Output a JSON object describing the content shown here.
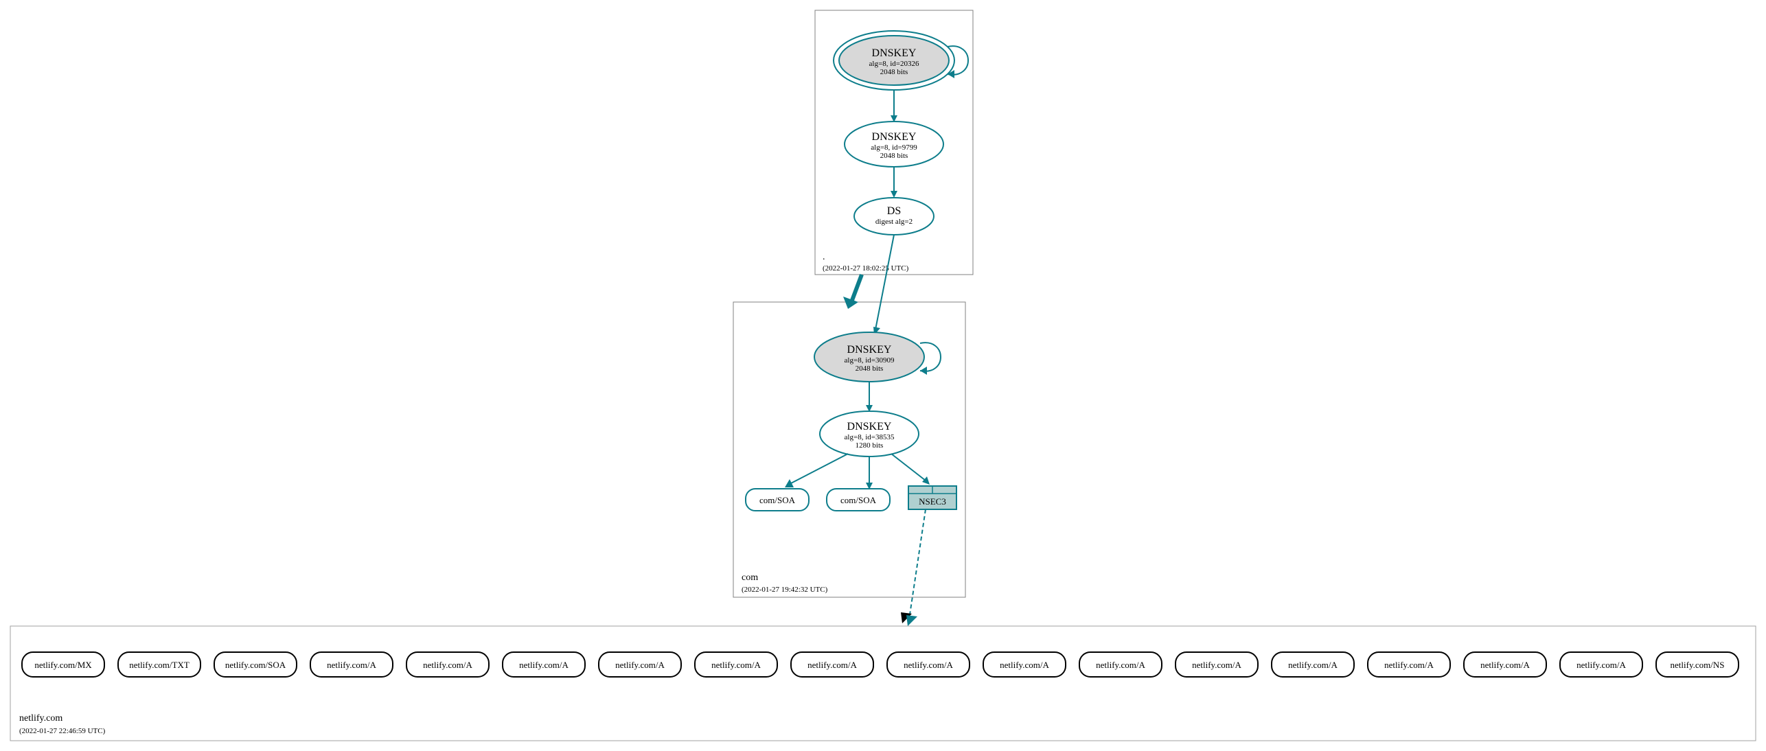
{
  "colors": {
    "teal": "#0d7d8b",
    "grey_fill": "#d8d8d8",
    "nsec3_fill": "#b0d0d0",
    "box_stroke": "#808080"
  },
  "zones": {
    "root": {
      "name": ".",
      "timestamp": "(2022-01-27 18:02:25 UTC)",
      "ksk": {
        "title": "DNSKEY",
        "line1": "alg=8, id=20326",
        "line2": "2048 bits"
      },
      "zsk": {
        "title": "DNSKEY",
        "line1": "alg=8, id=9799",
        "line2": "2048 bits"
      },
      "ds": {
        "title": "DS",
        "line1": "digest alg=2"
      }
    },
    "com": {
      "name": "com",
      "timestamp": "(2022-01-27 19:42:32 UTC)",
      "ksk": {
        "title": "DNSKEY",
        "line1": "alg=8, id=30909",
        "line2": "2048 bits"
      },
      "zsk": {
        "title": "DNSKEY",
        "line1": "alg=8, id=38535",
        "line2": "1280 bits"
      },
      "rr": {
        "soa1": "com/SOA",
        "soa2": "com/SOA",
        "nsec3": "NSEC3"
      }
    },
    "netlify": {
      "name": "netlify.com",
      "timestamp": "(2022-01-27 22:46:59 UTC)",
      "records": [
        "netlify.com/MX",
        "netlify.com/TXT",
        "netlify.com/SOA",
        "netlify.com/A",
        "netlify.com/A",
        "netlify.com/A",
        "netlify.com/A",
        "netlify.com/A",
        "netlify.com/A",
        "netlify.com/A",
        "netlify.com/A",
        "netlify.com/A",
        "netlify.com/A",
        "netlify.com/A",
        "netlify.com/A",
        "netlify.com/A",
        "netlify.com/A",
        "netlify.com/NS"
      ]
    }
  }
}
